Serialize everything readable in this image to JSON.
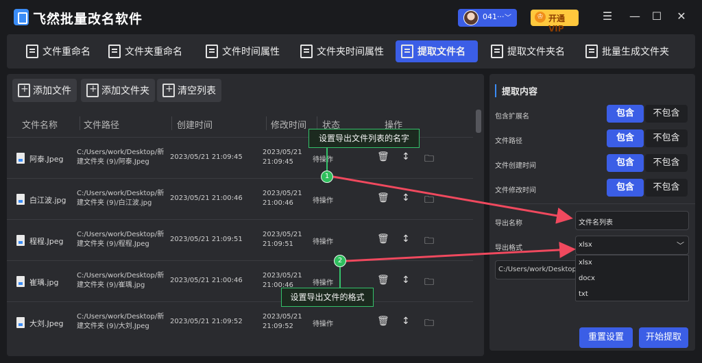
{
  "app": {
    "title": "飞然批量改名软件",
    "user": "041···",
    "vip": "开通VIP"
  },
  "window_controls": {
    "menu": "☰",
    "minimize": "—",
    "maximize": "☐",
    "close": "✕"
  },
  "tabs": [
    {
      "label": "文件重命名"
    },
    {
      "label": "文件夹重命名"
    },
    {
      "label": "文件时间属性"
    },
    {
      "label": "文件夹时间属性"
    },
    {
      "label": "提取文件名"
    },
    {
      "label": "提取文件夹名"
    },
    {
      "label": "批量生成文件夹"
    }
  ],
  "active_tab": "提取文件名",
  "toolbar": {
    "add_file": "添加文件",
    "add_folder": "添加文件夹",
    "clear_list": "清空列表"
  },
  "table": {
    "headers": [
      "文件名称",
      "文件路径",
      "创建时间",
      "修改时间",
      "状态",
      "操作"
    ],
    "rows": [
      {
        "name": "阿泰.Jpeg",
        "path": "C:/Users/work/Desktop/新建文件夹 (9)/阿泰.Jpeg",
        "created": "2023/05/21 21:09:45",
        "modified": "2023/05/21 21:09:45",
        "status": "待操作"
      },
      {
        "name": "白江波.jpg",
        "path": "C:/Users/work/Desktop/新建文件夹 (9)/白江波.jpg",
        "created": "2023/05/21 21:00:46",
        "modified": "2023/05/21 21:00:46",
        "status": "待操作"
      },
      {
        "name": "程程.Jpeg",
        "path": "C:/Users/work/Desktop/新建文件夹 (9)/程程.Jpeg",
        "created": "2023/05/21 21:09:51",
        "modified": "2023/05/21 21:09:51",
        "status": "待操作"
      },
      {
        "name": "崔瑀.jpg",
        "path": "C:/Users/work/Desktop/新建文件夹 (9)/崔瑀.jpg",
        "created": "2023/05/21 21:00:46",
        "modified": "2023/05/21 21:00:46",
        "status": "待操作"
      },
      {
        "name": "大刘.Jpeg",
        "path": "C:/Users/work/Desktop/新建文件夹 (9)/大刘.Jpeg",
        "created": "2023/05/21 21:09:52",
        "modified": "2023/05/21 21:09:52",
        "status": "待操作"
      }
    ],
    "op_icons": [
      "trash-icon",
      "move-icon",
      "folder-icon"
    ]
  },
  "extract": {
    "title": "提取内容",
    "options": [
      {
        "label": "包含扩展名",
        "on": "包含",
        "off": "不包含"
      },
      {
        "label": "文件路径",
        "on": "包含",
        "off": "不包含"
      },
      {
        "label": "文件创建时间",
        "on": "包含",
        "off": "不包含"
      },
      {
        "label": "文件修改时间",
        "on": "包含",
        "off": "不包含"
      }
    ],
    "export_name_label": "导出名称",
    "export_name_value": "文件名列表",
    "export_format_label": "导出格式",
    "export_format_value": "xlsx",
    "format_options": [
      "xlsx",
      "docx",
      "txt"
    ],
    "output_path": "C:/Users/work/Desktop",
    "reset": "重置设置",
    "start": "开始提取"
  },
  "annotations": [
    {
      "number": "1",
      "text": "设置导出文件列表的名字"
    },
    {
      "number": "2",
      "text": "设置导出文件的格式"
    }
  ],
  "colors": {
    "accent": "#3b5ee6",
    "annotation": "#34c36b",
    "arrow": "#f0495e",
    "vip": "#ffc83d"
  }
}
